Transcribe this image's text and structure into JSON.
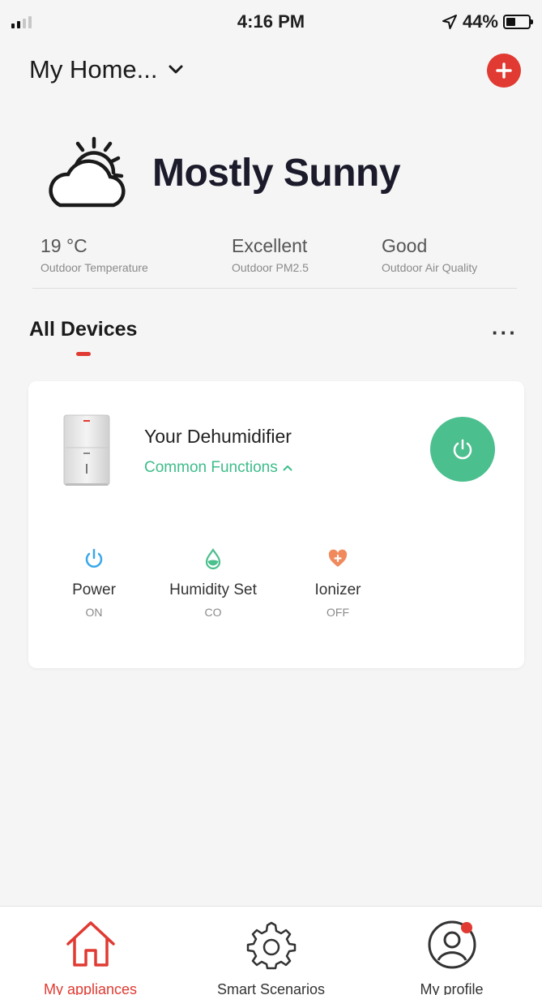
{
  "status_bar": {
    "time": "4:16 PM",
    "battery": "44%",
    "battery_level": 0.44
  },
  "header": {
    "title": "My Home..."
  },
  "weather": {
    "condition": "Mostly Sunny",
    "metrics": [
      {
        "value": "19 °C",
        "label": "Outdoor Temperature"
      },
      {
        "value": "Excellent",
        "label": "Outdoor PM2.5"
      },
      {
        "value": "Good",
        "label": "Outdoor Air Quality"
      }
    ]
  },
  "devices": {
    "section_title": "All Devices",
    "more_label": "···",
    "card": {
      "name": "Your Dehumidifier",
      "functions_toggle": "Common Functions",
      "functions": [
        {
          "label": "Power",
          "value": "ON"
        },
        {
          "label": "Humidity Set",
          "value": "CO"
        },
        {
          "label": "Ionizer",
          "value": "OFF"
        }
      ]
    }
  },
  "tabs": [
    {
      "label": "My appliances",
      "icon": "home-icon",
      "active": true
    },
    {
      "label": "Smart Scenarios",
      "icon": "gear-icon",
      "active": false
    },
    {
      "label": "My profile",
      "icon": "profile-icon",
      "active": false
    }
  ],
  "colors": {
    "accent": "#e03a32",
    "device_on": "#4cbf8e",
    "function_link": "#3dbd8a",
    "power_icon": "#3aa8e8",
    "humidity_icon": "#4cbf8e",
    "ionizer_icon": "#f08a5d"
  }
}
